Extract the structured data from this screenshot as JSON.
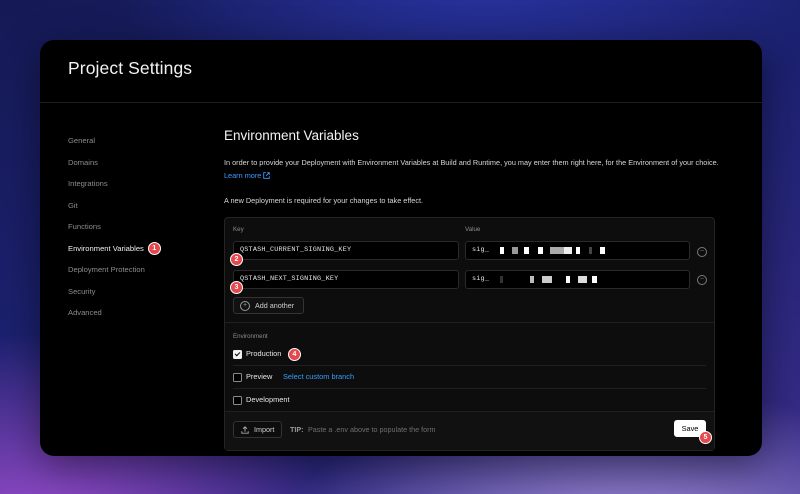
{
  "page_title": "Project Settings",
  "sidebar": {
    "items": [
      {
        "label": "General"
      },
      {
        "label": "Domains"
      },
      {
        "label": "Integrations"
      },
      {
        "label": "Git"
      },
      {
        "label": "Functions"
      },
      {
        "label": "Environment Variables",
        "active": true,
        "badge": "1"
      },
      {
        "label": "Deployment Protection"
      },
      {
        "label": "Security"
      },
      {
        "label": "Advanced"
      }
    ]
  },
  "main": {
    "title": "Environment Variables",
    "description": "In order to provide your Deployment with Environment Variables at Build and Runtime, you may enter them right here, for the Environment of your choice.",
    "learn_more": "Learn more",
    "notice": "A new Deployment is required for your changes to take effect."
  },
  "form": {
    "key_label": "Key",
    "value_label": "Value",
    "rows": [
      {
        "key": "QSTASH_CURRENT_SIGNING_KEY",
        "value_prefix": "sig_",
        "badge": "2"
      },
      {
        "key": "QSTASH_NEXT_SIGNING_KEY",
        "value_prefix": "sig_",
        "badge": "3"
      }
    ],
    "add_another": "Add another",
    "environment_label": "Environment",
    "environments": [
      {
        "label": "Production",
        "checked": true,
        "badge": "4"
      },
      {
        "label": "Preview",
        "checked": false,
        "link": "Select custom branch"
      },
      {
        "label": "Development",
        "checked": false
      }
    ],
    "import_label": "Import",
    "tip_label": "TIP:",
    "tip_text": "Paste a .env above to populate the form",
    "save_label": "Save",
    "save_badge": "5"
  }
}
